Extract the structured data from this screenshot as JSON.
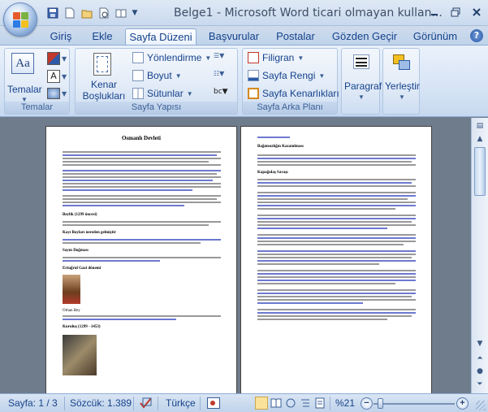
{
  "window": {
    "title": "Belge1 - Microsoft Word ticari olmayan kullan..."
  },
  "tabs": [
    {
      "label": "Giriş"
    },
    {
      "label": "Ekle"
    },
    {
      "label": "Sayfa Düzeni"
    },
    {
      "label": "Başvurular"
    },
    {
      "label": "Postalar"
    },
    {
      "label": "Gözden Geçir"
    },
    {
      "label": "Görünüm"
    }
  ],
  "ribbon": {
    "themes": {
      "button": "Temalar",
      "group": "Temalar"
    },
    "page_setup": {
      "margins": "Kenar Boşlukları",
      "orientation": "Yönlendirme",
      "size": "Boyut",
      "columns": "Sütunlar",
      "group": "Sayfa Yapısı"
    },
    "page_background": {
      "watermark": "Filigran",
      "page_color": "Sayfa Rengi",
      "page_borders": "Sayfa Kenarlıkları",
      "group": "Sayfa Arka Planı"
    },
    "paragraph": "Paragraf",
    "arrange": "Yerleştir"
  },
  "document": {
    "page1_title": "Osmanlı Devleti",
    "page1_headings": [
      "Beylik (1299 öncesi)",
      "Kayı Boyları nereden gelmiştir",
      "Sayın Doğması",
      "Ertuğrul Gazi dönemi",
      "Orhan Bey",
      "Kuruluş (1299 - 1453)"
    ],
    "page2_headings": [
      "Bağımsızlığın Kazanılması",
      "Kapağıdaş Savaşı"
    ]
  },
  "status": {
    "page": "Sayfa: 1 / 3",
    "words": "Sözcük: 1.389",
    "language": "Türkçe",
    "zoom": "%21"
  }
}
